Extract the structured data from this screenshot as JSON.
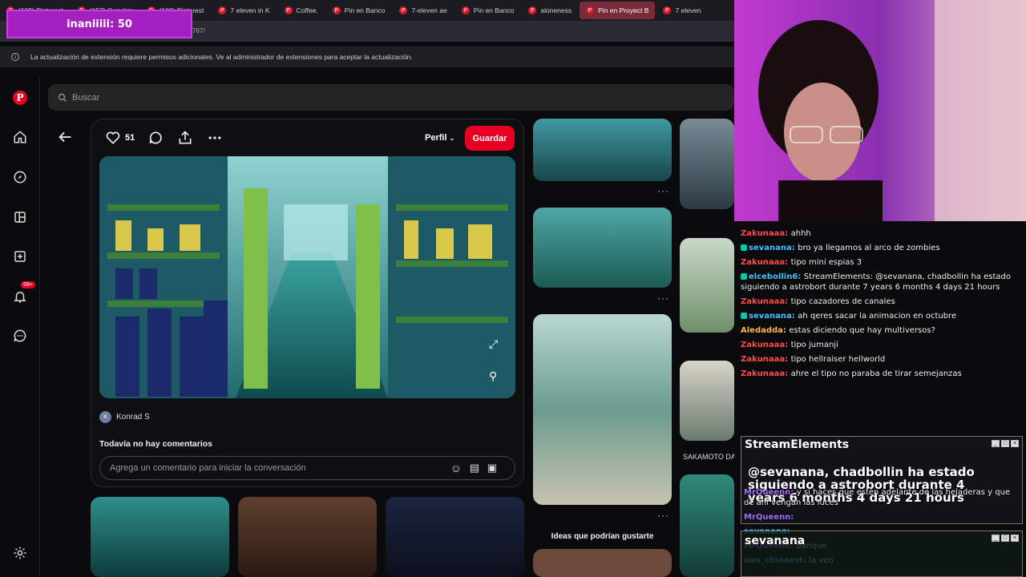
{
  "browser": {
    "tabs": [
      {
        "label": "(100) Pinterest",
        "active": false
      },
      {
        "label": "(157) Genshin",
        "active": false
      },
      {
        "label": "(100) Pinterest",
        "active": false
      },
      {
        "label": "7 eleven in K",
        "active": false
      },
      {
        "label": "Coffee.",
        "active": false
      },
      {
        "label": "Pin en Banco",
        "active": false
      },
      {
        "label": "7-eleven ae",
        "active": false
      },
      {
        "label": "Pin en Banco",
        "active": false
      },
      {
        "label": "aloneness",
        "active": false
      },
      {
        "label": "Pin en Proyect B",
        "active": true
      },
      {
        "label": "7 eleven",
        "active": false
      }
    ],
    "url_fragment": "767/",
    "info_message": "La actualización de extensión requiere permisos adicionales. Ve al administrador de extensiones para aceptar la actualización."
  },
  "stream_overlay": {
    "counter_text": "inaniiiii: 50"
  },
  "sidebar": {
    "logo": "P",
    "notif_badge": "99+",
    "items": [
      "home-icon",
      "explore-icon",
      "boards-icon",
      "create-icon",
      "notifications-icon",
      "messages-icon",
      "settings-icon"
    ]
  },
  "search": {
    "placeholder": "Buscar"
  },
  "pin": {
    "like_count": "51",
    "profile_label": "Perfil",
    "save_label": "Guardar",
    "author_initial": "K",
    "author": "Konrad S",
    "no_comments": "Todavía no hay comentarios",
    "comment_placeholder": "Agrega un comentario para iniciar la conversación"
  },
  "feed": {
    "ideas_heading": "Ideas que podrían gustarte",
    "side_caption": "SAKAMOTO DA"
  },
  "chat": {
    "messages": [
      {
        "user": "Zakunaaa",
        "color": "#ff4d4d",
        "text": "ahhh",
        "badge": false
      },
      {
        "user": "sevanana",
        "color": "#3ec4ff",
        "text": "bro ya llegamos al arco de zombies",
        "badge": true
      },
      {
        "user": "Zakunaaa",
        "color": "#ff4d4d",
        "text": "tipo mini espias 3",
        "badge": false
      },
      {
        "user": "elcebollin6",
        "color": "#3ec4ff",
        "text": "StreamElements: @sevanana, chadbollin ha estado siguiendo a astrobort durante 7 years 6 months 4 days 21 hours",
        "badge": true
      },
      {
        "user": "Zakunaaa",
        "color": "#ff4d4d",
        "text": "tipo cazadores de canales",
        "badge": false
      },
      {
        "user": "sevanana",
        "color": "#3ec4ff",
        "text": "ah qeres sacar la animacion en octubre",
        "badge": true
      },
      {
        "user": "Aledadda",
        "color": "#ffb74d",
        "text": "estas diciendo que hay multiversos?",
        "badge": false
      },
      {
        "user": "Zakunaaa",
        "color": "#ff4d4d",
        "text": "tipo jumanji",
        "badge": false
      },
      {
        "user": "Zakunaaa",
        "color": "#ff4d4d",
        "text": "tipo hellraiser hellworld",
        "badge": false
      },
      {
        "user": "Zakunaaa",
        "color": "#ff4d4d",
        "text": "ahre el tipo no paraba de tirar semejanzas",
        "badge": false
      }
    ],
    "popup_title": "StreamElements",
    "popup_text": "@sevanana, chadbollin ha estado siguiendo a astrobort durante 4 years 6 months 4 days 21 hours",
    "lower_messages": [
      {
        "user": "MrQueenn",
        "color": "#a66bff",
        "text": "y si haces que estén adelante de las heladeras y que de ahí vengan las luces"
      },
      {
        "user": "MrQueenn",
        "color": "#a66bff",
        "text": ""
      },
      {
        "user": "sevanana",
        "color": "#3ec4ff",
        "text": ""
      },
      {
        "user": "MrQueenn",
        "color": "#a66bff",
        "text": "banque"
      },
      {
        "user": "uan_chinaest",
        "color": "#3ec4ff",
        "text": "la veo"
      }
    ],
    "popup2_title": "sevanana"
  },
  "colors": {
    "pinterest_red": "#e60023",
    "overlay_purple": "#a31fbf"
  }
}
